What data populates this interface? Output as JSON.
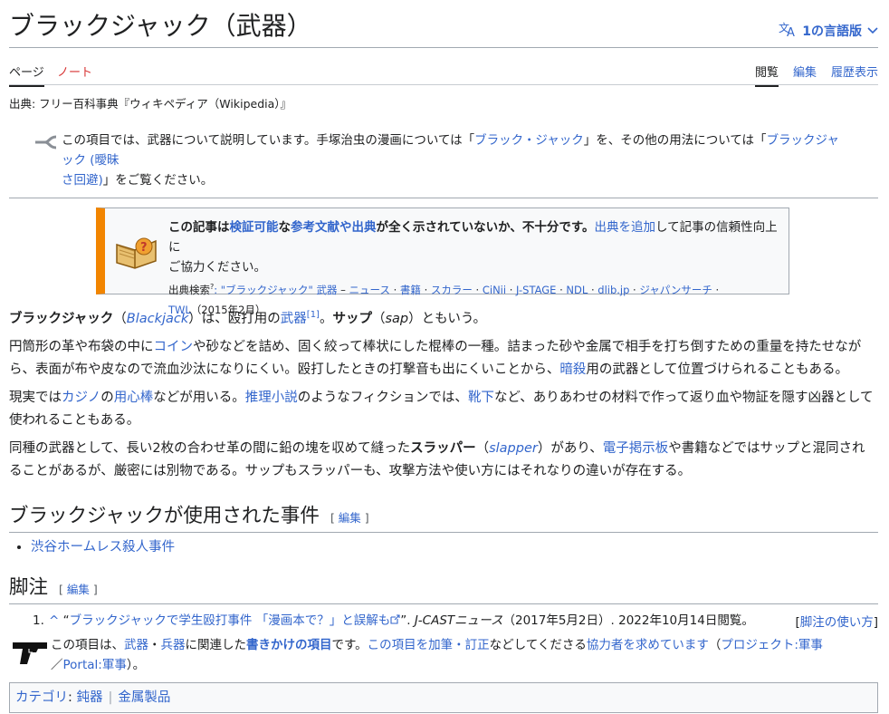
{
  "title": "ブラックジャック（武器）",
  "language_button": "1の言語版",
  "tabs": {
    "page": "ページ",
    "talk": "ノート",
    "read": "閲覧",
    "edit": "編集",
    "history": "履歴表示"
  },
  "source_line": "出典: フリー百科事典『ウィキペディア（Wikipedia）』",
  "hatnote": {
    "t1": "この項目では、武器について説明しています。手塚治虫の漫画については「",
    "l1": "ブラック・ジャック",
    "t2": "」を、その他の用法については「",
    "l2a": "ブラックジャック (曖昧",
    "l2b": "さ回避)",
    "t3": "」をご覧ください。"
  },
  "ambox": {
    "t1": "この記事は",
    "l1": "検証可能",
    "t2": "な",
    "l2": "参考文献や出典",
    "t3": "が全く示されていないか、不十分です。",
    "l3": "出典を追加",
    "t4": "して記事の信頼性向上に",
    "t5": "ご協力ください。",
    "search_label": "出典検索",
    "search_q": ": \"ブラックジャック\" 武器",
    "links": [
      "ニュース",
      "書籍",
      "スカラー",
      "CiNii",
      "J-STAGE",
      "NDL",
      "dlib.jp",
      "ジャパンサーチ",
      "TWL"
    ],
    "date": "（2015年2月）"
  },
  "p1": {
    "t1": "ブラックジャック",
    "t2": "（",
    "l1": "Blackjack",
    "t3": "）は、殴打用の",
    "l2": "武器",
    "ref": "[1]",
    "t4": "。",
    "t5": "サップ",
    "t6": "（",
    "t7": "sap",
    "t8": "）ともいう。"
  },
  "p2": {
    "t1": "円筒形の革や布袋の中に",
    "l1": "コイン",
    "t2": "や砂などを詰め、固く絞って棒状にした棍棒の一種。詰まった砂や金属で相手を打ち倒すための重量を持たせなが",
    "t3": "ら、表面が布や皮なので流血沙汰になりにくい。殴打したときの打撃音も出にくいことから、",
    "l2": "暗殺",
    "t4": "用の武器として位置づけられることもある。"
  },
  "p3": {
    "t1": "現実では",
    "l1": "カジノ",
    "t2": "の",
    "l2": "用心棒",
    "t3": "などが用いる。",
    "l3": "推理小説",
    "t4": "のようなフィクションでは、",
    "l4": "靴下",
    "t5": "など、ありあわせの材料で作って返り血や物証を隠す凶器として",
    "t6": "使われることもある。"
  },
  "p4": {
    "t1": "同種の武器として、長い2枚の合わせ革の間に鉛の塊を収めて縫った",
    "t2": "スラッパー",
    "t3": "（",
    "l1": "slapper",
    "t4": "）があり、",
    "l2": "電子掲示板",
    "t5": "や書籍などではサップと混同され",
    "t6": "ることがあるが、厳密には別物である。サップもスラッパーも、攻撃方法や使い方にはそれなりの違いが存在する。"
  },
  "section1": {
    "heading": "ブラックジャックが使用された事件",
    "edit": "編集",
    "items": [
      "渋谷ホームレス殺人事件"
    ]
  },
  "section2": {
    "heading": "脚注",
    "edit": "編集"
  },
  "ref1": {
    "num": "1.",
    "caret": "^",
    "q1": "“",
    "link": "ブラックジャックで学生殴打事件 「漫画本で？」と誤解も",
    "q2": "”.",
    "pub": "J-CASTニュース",
    "rest": "（2017年5月2日）. 2022年10月14日閲覧。",
    "howto": "脚注の使い方"
  },
  "stub": {
    "t1": "この項目は、",
    "l1": "武器",
    "t2": "・",
    "l2": "兵器",
    "t3": "に関連した",
    "l3": "書きかけの項目",
    "t4": "です。",
    "l4": "この項目を加筆・訂正",
    "t5": "などしてくださる",
    "l5": "協力者を求めています",
    "t6": "（",
    "l6": "プロジェクト:軍事",
    "t7": "／",
    "l7": "Portal:軍事",
    "t8": "）。"
  },
  "categories": {
    "label": "カテゴリ",
    "items": [
      "鈍器",
      "金属製品"
    ]
  }
}
